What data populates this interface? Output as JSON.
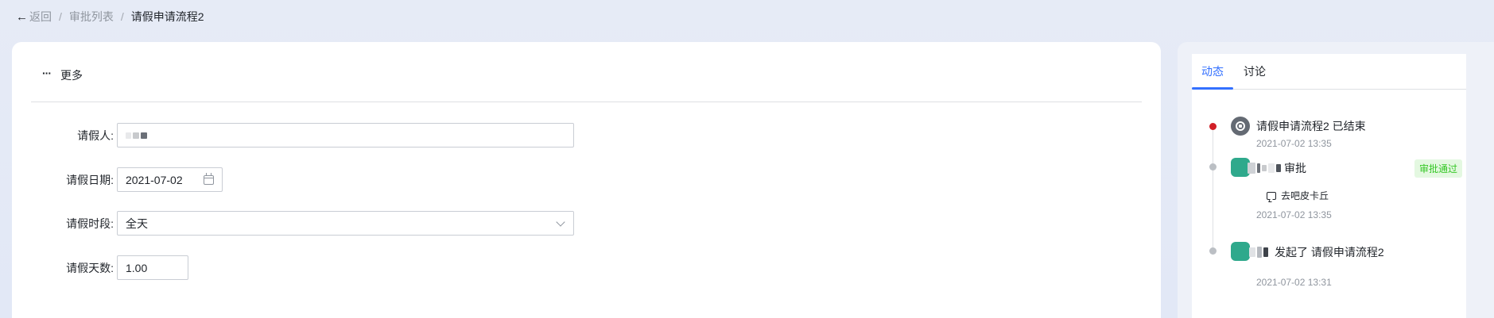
{
  "breadcrumb": {
    "back_arrow": "←",
    "back_label": "返回",
    "sep": "/",
    "list_label": "审批列表",
    "current_label": "请假申请流程2"
  },
  "toolbar": {
    "more_dots": "···",
    "more_label": "更多"
  },
  "form": {
    "applicant_label": "请假人:",
    "date_label": "请假日期:",
    "date_value": "2021-07-02",
    "period_label": "请假时段:",
    "period_value": "全天",
    "days_label": "请假天数:",
    "days_value": "1.00"
  },
  "side": {
    "tab_activity": "动态",
    "tab_discussion": "讨论",
    "events": [
      {
        "title": "请假申请流程2 已结束",
        "time": "2021-07-02 13:35"
      },
      {
        "action": "审批",
        "badge": "审批通过",
        "comment": "去吧皮卡丘",
        "time": "2021-07-02 13:35"
      },
      {
        "action": "发起了 请假申请流程2",
        "time": "2021-07-02 13:31"
      }
    ]
  },
  "colors": {
    "accent": "#3370ff",
    "end_dot": "#d11f27",
    "avatar": "#2fa98c",
    "pass_green": "#34c724"
  }
}
